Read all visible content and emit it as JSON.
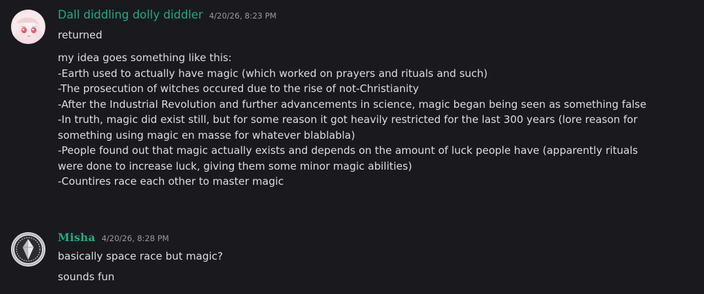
{
  "messages": [
    {
      "author": "Dall diddling dolly diddler",
      "timestamp": "4/20/26, 8:23 PM",
      "author_color": "#1fa98a",
      "avatar_icon": "anime-girl-avatar-icon",
      "paragraphs": [
        [
          "returned"
        ],
        [
          "my idea goes something like this:",
          "-Earth used to actually have magic (which worked on prayers and rituals and such)",
          "-The prosecution of witches occured due to the rise of not-Christianity",
          "-After the Industrial Revolution and further advancements in science, magic began being seen as something false",
          "-In truth, magic did exist still, but for some reason it got heavily restricted for the last 300 years (lore reason for",
          "something using magic en masse for whatever blablabla)",
          "-People found out that magic actually exists and depends on the amount of luck people have (apparently rituals",
          "were done to increase luck, giving them some minor magic abilities)",
          "-Countires race each other to master magic"
        ]
      ]
    },
    {
      "author": "Misha",
      "timestamp": "4/20/26, 8:28 PM",
      "author_color": "#1fa98a",
      "avatar_icon": "crystal-emblem-avatar-icon",
      "paragraphs": [
        [
          "basically space race but magic?"
        ],
        [
          "sounds fun"
        ]
      ]
    }
  ]
}
